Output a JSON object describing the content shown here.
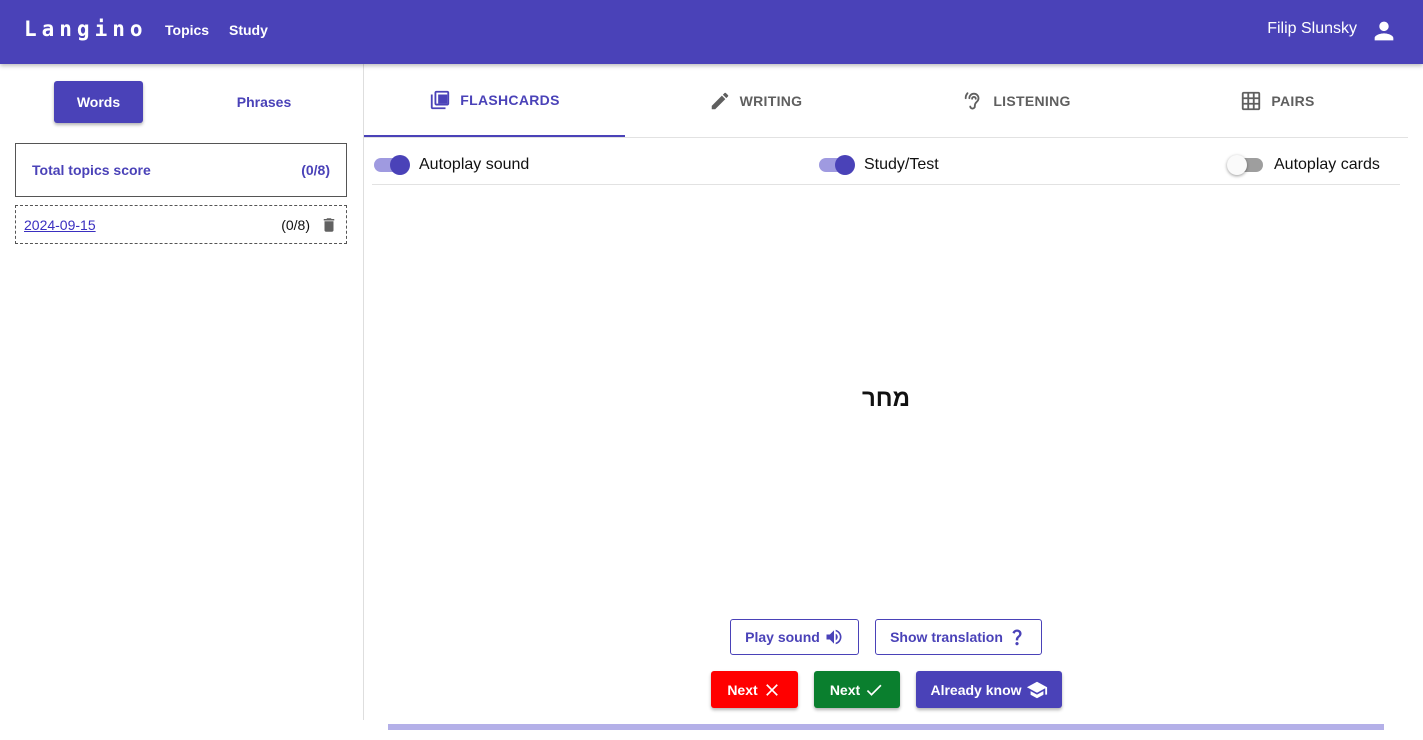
{
  "app": {
    "logo": "Langino",
    "nav": [
      "Topics",
      "Study"
    ],
    "user_name": "Filip Slunsky"
  },
  "sidebar": {
    "mode_tabs": [
      {
        "label": "Words",
        "active": true
      },
      {
        "label": "Phrases",
        "active": false
      }
    ],
    "total_score": {
      "label": "Total topics score",
      "value": "(0/8)"
    },
    "topics": [
      {
        "date": "2024-09-15",
        "score": "(0/8)"
      }
    ]
  },
  "study_tabs": [
    {
      "label": "FLASHCARDS",
      "icon": "flashcards-icon",
      "active": true
    },
    {
      "label": "WRITING",
      "icon": "pencil-icon",
      "active": false
    },
    {
      "label": "LISTENING",
      "icon": "ear-icon",
      "active": false
    },
    {
      "label": "PAIRS",
      "icon": "grid-icon",
      "active": false
    }
  ],
  "toggles": [
    {
      "label": "Autoplay sound",
      "on": true
    },
    {
      "label": "Study/Test",
      "on": true
    },
    {
      "label": "Autoplay cards",
      "on": false
    }
  ],
  "card": {
    "word": "מחר"
  },
  "actions": {
    "play_sound": "Play sound",
    "show_translation": "Show translation",
    "next_wrong": "Next",
    "next_right": "Next",
    "already_know": "Already know"
  },
  "colors": {
    "primary": "#4a42b8",
    "wrong": "#ff0000",
    "right": "#0a7f2e",
    "progress": "#b4b0e8"
  },
  "progress": {
    "fraction": 1.0
  }
}
